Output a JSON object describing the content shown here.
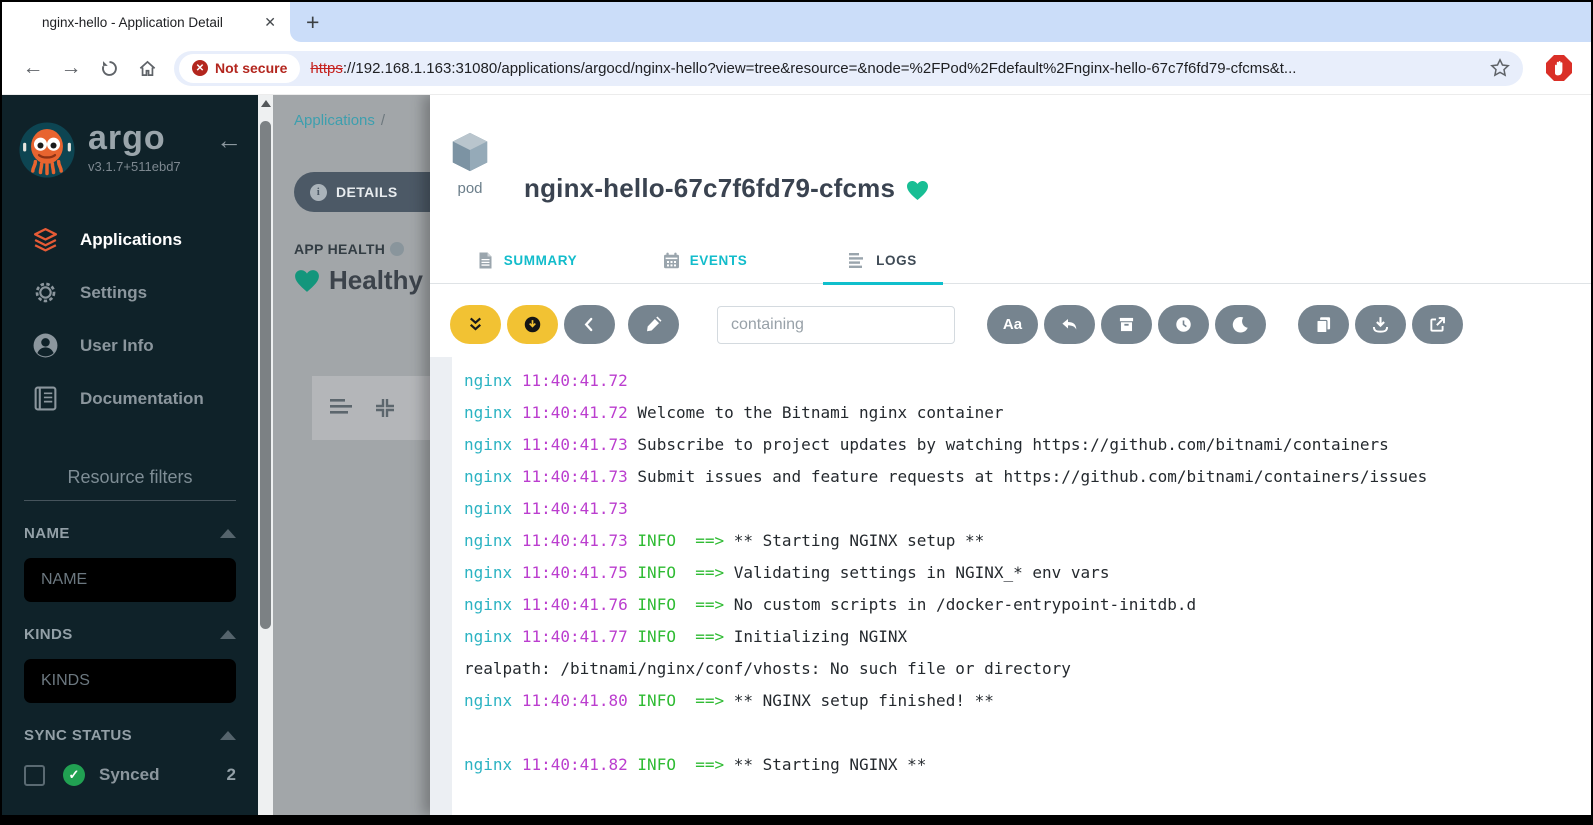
{
  "browser": {
    "tab_title": "nginx-hello - Application Detail",
    "new_tab_label": "+",
    "close_label": "✕",
    "security_chip": "Not secure",
    "url_scheme": "https",
    "url_rest": "://192.168.1.163:31080/applications/argocd/nginx-hello?view=tree&resource=&node=%2FPod%2Fdefault%2Fnginx-hello-67c7f6fd79-cfcms&t..."
  },
  "sidebar": {
    "logo": "argo",
    "version": "v3.1.7+511ebd7",
    "menu": [
      {
        "label": "Applications",
        "icon": "layers-icon",
        "active": true
      },
      {
        "label": "Settings",
        "icon": "gear-icon",
        "active": false
      },
      {
        "label": "User Info",
        "icon": "user-icon",
        "active": false
      },
      {
        "label": "Documentation",
        "icon": "book-icon",
        "active": false
      }
    ],
    "filters": {
      "title": "Resource filters",
      "groups": [
        {
          "label": "NAME",
          "placeholder": "NAME"
        },
        {
          "label": "KINDS",
          "placeholder": "KINDS"
        }
      ],
      "sync_status_label": "SYNC STATUS",
      "sync_options": [
        {
          "label": "Synced",
          "count": "2"
        }
      ]
    }
  },
  "backdrop": {
    "breadcrumb": "Applications",
    "breadcrumb_separator": "/",
    "details_button": "DETAILS",
    "app_health_label": "APP HEALTH",
    "health_status": "Healthy"
  },
  "panel": {
    "kind_label": "pod",
    "title": "nginx-hello-67c7f6fd79-cfcms",
    "tabs": [
      {
        "label": "SUMMARY",
        "icon": "document-icon",
        "active": false
      },
      {
        "label": "EVENTS",
        "icon": "calendar-icon",
        "active": false
      },
      {
        "label": "LOGS",
        "icon": "log-lines-icon",
        "active": true
      }
    ],
    "toolbar": {
      "filter_placeholder": "containing",
      "buttons_left": [
        {
          "name": "follow-logs-button",
          "icon": "double-chevron-down-icon",
          "style": "yellow"
        },
        {
          "name": "tail-logs-button",
          "icon": "download-circle-icon",
          "style": "yellow"
        },
        {
          "name": "page-back-button",
          "icon": "chevron-left-icon",
          "style": "gray mr"
        },
        {
          "name": "highlight-button",
          "icon": "pen-icon",
          "style": "gray"
        }
      ],
      "buttons_right": [
        {
          "name": "match-case-button",
          "icon": "match-case-icon",
          "style": "gray",
          "text": "Aa"
        },
        {
          "name": "wrap-lines-button",
          "icon": "wrap-lines-icon",
          "style": "gray"
        },
        {
          "name": "container-select-button",
          "icon": "archive-box-icon",
          "style": "gray"
        },
        {
          "name": "timestamps-button",
          "icon": "clock-icon",
          "style": "gray"
        },
        {
          "name": "dark-mode-button",
          "icon": "moon-icon",
          "style": "gray"
        }
      ],
      "buttons_far_right": [
        {
          "name": "copy-logs-button",
          "icon": "copy-icon",
          "style": "gray"
        },
        {
          "name": "download-logs-button",
          "icon": "download-icon",
          "style": "gray"
        },
        {
          "name": "open-logs-button",
          "icon": "external-link-icon",
          "style": "gray"
        }
      ]
    },
    "log_info_prefix": "INFO  ==>",
    "logs": [
      {
        "src": "nginx",
        "time": "11:40:41.72",
        "info": false,
        "msg": ""
      },
      {
        "src": "nginx",
        "time": "11:40:41.72",
        "info": false,
        "msg": "Welcome to the Bitnami nginx container"
      },
      {
        "src": "nginx",
        "time": "11:40:41.73",
        "info": false,
        "msg": "Subscribe to project updates by watching https://github.com/bitnami/containers"
      },
      {
        "src": "nginx",
        "time": "11:40:41.73",
        "info": false,
        "msg": "Submit issues and feature requests at https://github.com/bitnami/containers/issues"
      },
      {
        "src": "nginx",
        "time": "11:40:41.73",
        "info": false,
        "msg": ""
      },
      {
        "src": "nginx",
        "time": "11:40:41.73",
        "info": true,
        "msg": "** Starting NGINX setup **"
      },
      {
        "src": "nginx",
        "time": "11:40:41.75",
        "info": true,
        "msg": "Validating settings in NGINX_* env vars"
      },
      {
        "src": "nginx",
        "time": "11:40:41.76",
        "info": true,
        "msg": "No custom scripts in /docker-entrypoint-initdb.d"
      },
      {
        "src": "nginx",
        "time": "11:40:41.77",
        "info": true,
        "msg": "Initializing NGINX"
      },
      {
        "src": "",
        "time": "",
        "info": false,
        "msg": "realpath: /bitnami/nginx/conf/vhosts: No such file or directory"
      },
      {
        "src": "nginx",
        "time": "11:40:41.80",
        "info": true,
        "msg": "** NGINX setup finished! **"
      },
      {
        "src": "",
        "time": "",
        "info": false,
        "msg": ""
      },
      {
        "src": "nginx",
        "time": "11:40:41.82",
        "info": true,
        "msg": "** Starting NGINX **"
      }
    ]
  },
  "colors": {
    "accent_teal": "#12bccb",
    "healthy_green": "#18be94",
    "log_source_teal": "#2bb3c2",
    "log_time_magenta": "#bb3ecf",
    "log_info_green": "#2fbb33",
    "button_yellow": "#f2c233",
    "button_gray": "#76848f",
    "sidebar_bg": "#0f2229",
    "synced_green": "#21a152",
    "not_secure_red": "#b3261e"
  }
}
